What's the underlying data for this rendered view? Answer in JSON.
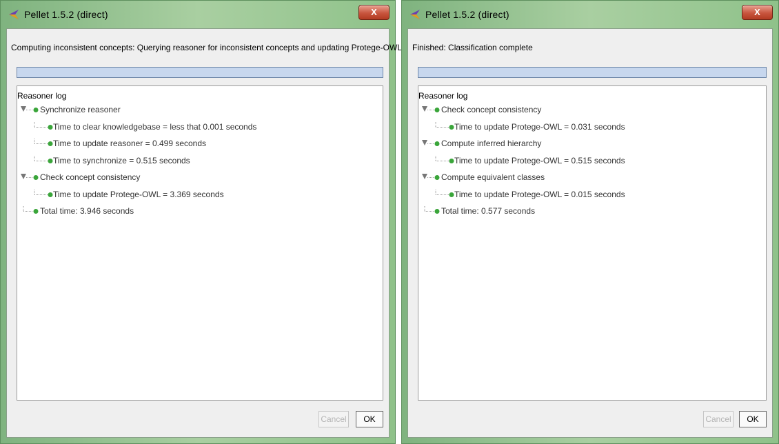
{
  "left_window": {
    "title": "Pellet 1.5.2 (direct)",
    "close_label": "X",
    "status": "Computing inconsistent concepts: Querying reasoner for inconsistent concepts and updating Protege-OWL...",
    "progress": 1.0,
    "log_header": "Reasoner log",
    "log": [
      {
        "text": "Synchronize reasoner",
        "level": 0,
        "expanded": true
      },
      {
        "text": "Time to clear knowledgebase = less that 0.001 seconds",
        "level": 1
      },
      {
        "text": "Time to update reasoner = 0.499 seconds",
        "level": 1
      },
      {
        "text": "Time to synchronize = 0.515 seconds",
        "level": 1
      },
      {
        "text": "Check concept consistency",
        "level": 0,
        "expanded": true
      },
      {
        "text": "Time to update Protege-OWL = 3.369 seconds",
        "level": 1
      },
      {
        "text": "Total time: 3.946 seconds",
        "level": 0,
        "leaf": true
      }
    ],
    "cancel_label": "Cancel",
    "ok_label": "OK"
  },
  "right_window": {
    "title": "Pellet 1.5.2 (direct)",
    "close_label": "X",
    "status": "Finished: Classification complete",
    "progress": 1.0,
    "log_header": "Reasoner log",
    "log": [
      {
        "text": "Check concept consistency",
        "level": 0,
        "expanded": true
      },
      {
        "text": "Time to update Protege-OWL = 0.031 seconds",
        "level": 1
      },
      {
        "text": "Compute inferred hierarchy",
        "level": 0,
        "expanded": true
      },
      {
        "text": "Time to update Protege-OWL = 0.515 seconds",
        "level": 1
      },
      {
        "text": "Compute equivalent classes",
        "level": 0,
        "expanded": true
      },
      {
        "text": "Time to update Protege-OWL = 0.015 seconds",
        "level": 1
      },
      {
        "text": "Total time: 0.577 seconds",
        "level": 0,
        "leaf": true
      }
    ],
    "cancel_label": "Cancel",
    "ok_label": "OK"
  },
  "colors": {
    "title_bar": "#9fca97",
    "progress_fill": "#c7d7ee",
    "tree_node": "#3aa53a",
    "close_button": "#c8553e"
  }
}
